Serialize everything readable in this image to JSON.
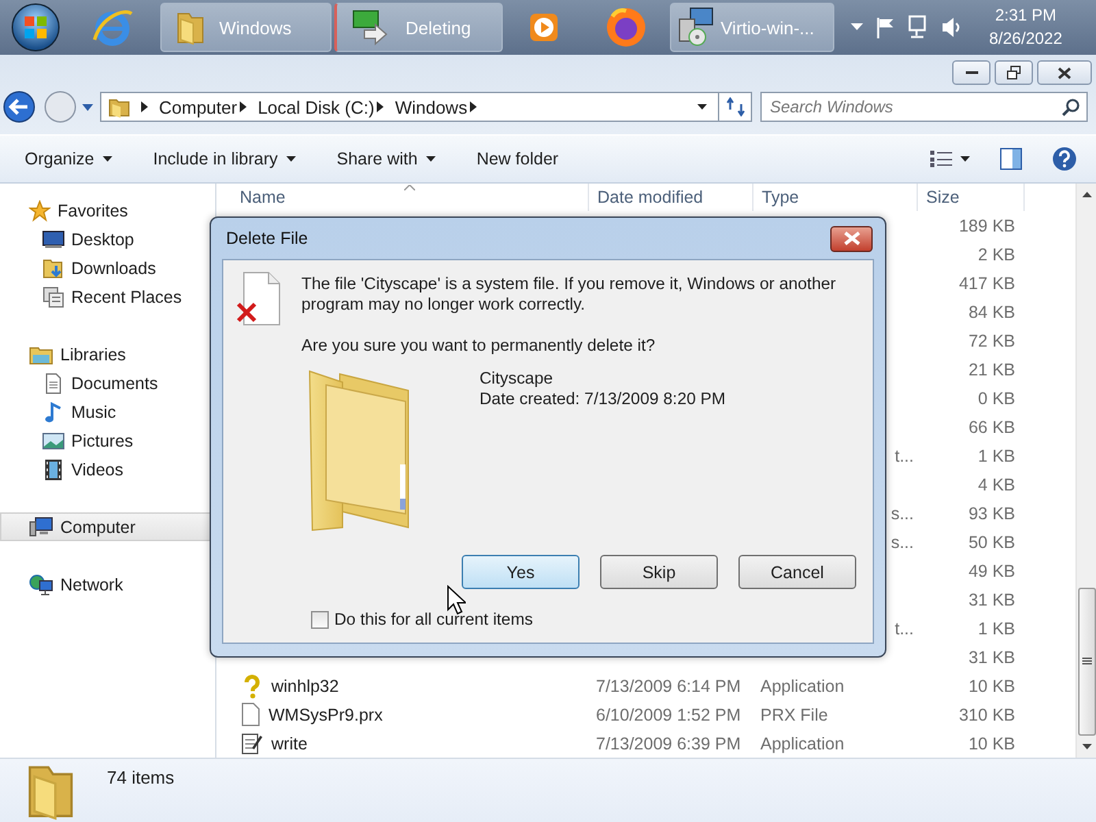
{
  "taskbar": {
    "items": [
      {
        "kind": "start"
      },
      {
        "kind": "ie"
      },
      {
        "kind": "folder",
        "label": "Windows"
      },
      {
        "kind": "transfer",
        "label": "Deleting"
      },
      {
        "kind": "media"
      },
      {
        "kind": "firefox"
      },
      {
        "kind": "installer",
        "label": "Virtio-win-..."
      }
    ],
    "tray": {
      "time": "2:31 PM",
      "date": "8/26/2022"
    }
  },
  "address": {
    "segments": [
      "Computer",
      "Local Disk (C:)",
      "Windows"
    ],
    "search_placeholder": "Search Windows"
  },
  "toolbar": {
    "commands": [
      {
        "label": "Organize",
        "dropdown": true
      },
      {
        "label": "Include in library",
        "dropdown": true
      },
      {
        "label": "Share with",
        "dropdown": true
      },
      {
        "label": "New folder",
        "dropdown": false
      }
    ]
  },
  "sidebar": {
    "groups": [
      {
        "label": "Favorites",
        "kind": "favorites",
        "selected": false,
        "children": [
          {
            "label": "Desktop",
            "kind": "desktop",
            "selected": false
          },
          {
            "label": "Downloads",
            "kind": "downloads",
            "selected": false
          },
          {
            "label": "Recent Places",
            "kind": "recent",
            "selected": false
          }
        ]
      },
      {
        "label": "Libraries",
        "kind": "libraries",
        "selected": false,
        "children": [
          {
            "label": "Documents",
            "kind": "documents",
            "selected": false
          },
          {
            "label": "Music",
            "kind": "music",
            "selected": false
          },
          {
            "label": "Pictures",
            "kind": "pictures",
            "selected": false
          },
          {
            "label": "Videos",
            "kind": "videos",
            "selected": false
          }
        ]
      },
      {
        "label": "Computer",
        "kind": "computer",
        "selected": true
      },
      {
        "label": "Network",
        "kind": "network",
        "selected": false
      }
    ]
  },
  "file_list": {
    "columns": [
      "Name",
      "Date modified",
      "Type",
      "Size"
    ],
    "rows": [
      {
        "kind": "covered",
        "size": "189 KB"
      },
      {
        "kind": "covered",
        "size": "2 KB"
      },
      {
        "kind": "covered",
        "size": "417 KB"
      },
      {
        "kind": "covered",
        "size": "84 KB"
      },
      {
        "kind": "covered",
        "size": "72 KB"
      },
      {
        "kind": "covered",
        "size": "21 KB"
      },
      {
        "kind": "covered",
        "size": "0 KB"
      },
      {
        "kind": "covered",
        "size": "66 KB"
      },
      {
        "kind": "covered",
        "type": "t...",
        "size": "1 KB"
      },
      {
        "kind": "covered",
        "size": "4 KB"
      },
      {
        "kind": "covered",
        "type": "s...",
        "size": "93 KB"
      },
      {
        "kind": "covered",
        "type": "s...",
        "size": "50 KB"
      },
      {
        "kind": "covered",
        "size": "49 KB"
      },
      {
        "kind": "covered",
        "size": "31 KB"
      },
      {
        "kind": "covered",
        "type": "t...",
        "size": "1 KB"
      },
      {
        "kind": "covered",
        "size": "31 KB"
      },
      {
        "kind": "help",
        "name": "winhlp32",
        "date": "7/13/2009 6:14 PM",
        "type": "Application",
        "size": "10 KB"
      },
      {
        "kind": "file",
        "name": "WMSysPr9.prx",
        "date": "6/10/2009 1:52 PM",
        "type": "PRX File",
        "size": "310 KB"
      },
      {
        "kind": "notepad",
        "name": "write",
        "date": "7/13/2009 6:39 PM",
        "type": "Application",
        "size": "10 KB"
      }
    ]
  },
  "status_bar": {
    "item_count": "74 items"
  },
  "dialog": {
    "title": "Delete File",
    "message": "The file 'Cityscape' is a system file. If you remove it, Windows or another program may no longer work correctly.",
    "question": "Are you sure you want to permanently delete it?",
    "item_name": "Cityscape",
    "item_detail": "Date created: 7/13/2009 8:20 PM",
    "buttons": [
      {
        "label": "Yes",
        "default": true
      },
      {
        "label": "Skip",
        "default": false
      },
      {
        "label": "Cancel",
        "default": false
      }
    ],
    "checkbox": {
      "label": "Do this for all current items",
      "checked": false
    }
  }
}
